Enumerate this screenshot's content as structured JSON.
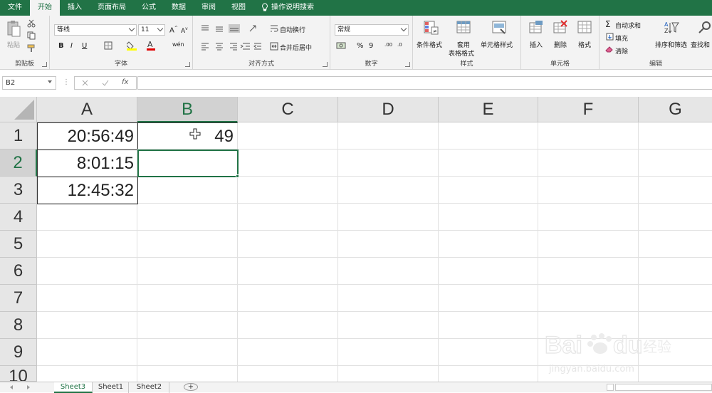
{
  "menu": {
    "tabs": [
      "文件",
      "开始",
      "插入",
      "页面布局",
      "公式",
      "数据",
      "审阅",
      "视图"
    ],
    "active_tab": "开始",
    "tell_me": "操作说明搜索"
  },
  "ribbon": {
    "clipboard": {
      "paste": "粘贴",
      "label": "剪贴板"
    },
    "font": {
      "font_name": "等线",
      "font_size": "11",
      "bold": "B",
      "italic": "I",
      "underline": "U",
      "label": "字体"
    },
    "alignment": {
      "wrap_text": "自动换行",
      "merge_center": "合并后居中",
      "label": "对齐方式"
    },
    "number": {
      "format": "常规",
      "percent": "%",
      "comma": "9",
      "label": "数字"
    },
    "styles": {
      "conditional": "条件格式",
      "table_l1": "套用",
      "table_l2": "表格格式",
      "cell_styles": "单元格样式",
      "label": "样式"
    },
    "cells": {
      "insert": "插入",
      "delete": "删除",
      "format": "格式",
      "label": "单元格"
    },
    "editing": {
      "autosum": "自动求和",
      "fill": "填充",
      "clear": "清除",
      "sort_filter": "排序和筛选",
      "find_select": "查找和",
      "label": "编辑"
    }
  },
  "formula_bar": {
    "name_box": "B2",
    "fx": "fx",
    "formula": ""
  },
  "grid": {
    "columns": [
      "A",
      "B",
      "C",
      "D",
      "E",
      "F",
      "G"
    ],
    "rows": [
      "1",
      "2",
      "3",
      "4",
      "5",
      "6",
      "7",
      "8",
      "9",
      "10"
    ],
    "cells": {
      "A1": "20:56:49",
      "A2": "8:01:15",
      "A3": "12:45:32",
      "B1": "49"
    },
    "selected_cell": "B2"
  },
  "sheets": {
    "tabs": [
      "Sheet3",
      "Sheet1",
      "Sheet2"
    ],
    "active": "Sheet3",
    "add": "+"
  },
  "watermark": {
    "brand": "Baidu经验",
    "url": "jingyan.baidu.com"
  },
  "colors": {
    "accent": "#217346",
    "header_bg": "#e6e6e6",
    "ribbon_bg": "#f3f3f3"
  }
}
